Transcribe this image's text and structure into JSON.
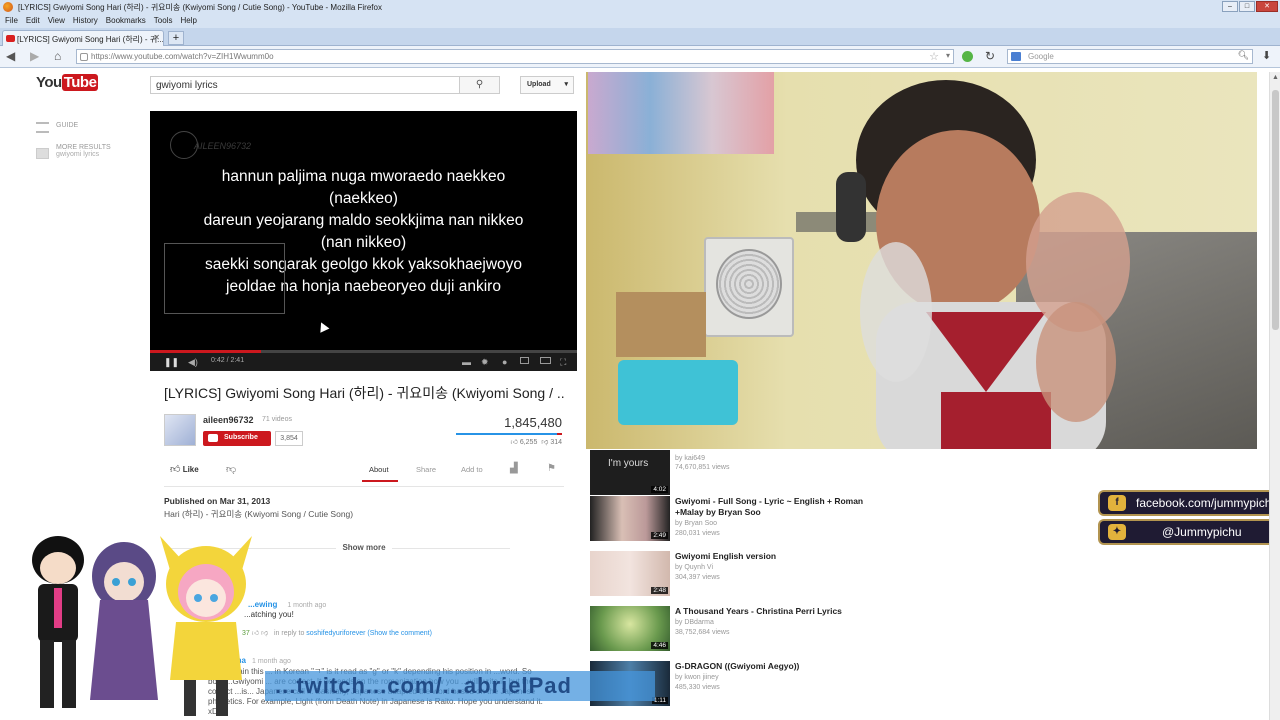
{
  "browser": {
    "window_title": "[LYRICS] Gwiyomi Song Hari (하리) - 귀요미송 (Kwiyomi Song / Cutie Song) - YouTube - Mozilla Firefox",
    "menu": [
      "File",
      "Edit",
      "View",
      "History",
      "Bookmarks",
      "Tools",
      "Help"
    ],
    "tab_title": "[LYRICS] Gwiyomi Song Hari (하리) - 귀...",
    "url": "https://www.youtube.com/watch?v=ZIH1Wwumm0o",
    "search_placeholder": "Google"
  },
  "youtube": {
    "logo_you": "You",
    "logo_tube": "Tube",
    "search_value": "gwiyomi lyrics",
    "upload_label": "Upload",
    "guide": {
      "guide_label": "GUIDE",
      "more_results": "MORE RESULTS",
      "more_results_sub": "gwiyomi lyrics"
    }
  },
  "player": {
    "watermark": "AILEEN96732",
    "lyrics": [
      "hannun paljima nuga mworaedo naekkeo",
      "(naekkeo)",
      "dareun yeojarang maldo seokkjima nan nikkeo",
      "(nan nikkeo)",
      "saekki songarak geolgo kkok yaksokhaejwoyo",
      "jeoldae na honja naebeoryeo duji ankiro"
    ],
    "time": "0:42 / 2:41",
    "progress_fraction": 0.26,
    "buffered_fraction": 0.57
  },
  "video": {
    "title": "[LYRICS] Gwiyomi Song Hari (하리) - 귀요미송 (Kwiyomi Song / ...",
    "uploader": "aileen96732",
    "video_count": "71 videos",
    "subscribe_label": "Subscribe",
    "subscriber_count": "3,854",
    "views": "1,845,480",
    "likes": "6,255",
    "dislikes": "314",
    "like_ratio": 0.95,
    "like_label": "Like",
    "tabs": [
      "About",
      "Share",
      "Add to"
    ],
    "published": "Published on Mar 31, 2013",
    "description": "Hari (하리) - 귀요미송 (Kwiyomi Song / Cutie Song)",
    "show_more": "Show more"
  },
  "comments": {
    "c1_name": "...ewing",
    "c1_ago": "1 month ago",
    "c1_text": "...atching you!",
    "c1_likes": "37",
    "c1_reply_to": "in reply to",
    "c1_reply_user": "soshifedyuriforever (Show the comment)",
    "c2_name": "...na",
    "c2_ago": "1 month ago",
    "c2_text": "...to explain this ... in Korean \"ㄱ\" is it read as \"g\" or \"k\" depending his position in ...word. So both ...Gwiyomi ... are correct. It depends on the romanization how you ...will write it, but the correct ...is... Japanese call it. Basically, Japanese adapted the word based on the Japanese phonetics. For example, Light (from Death Note) in Japanese is Raito. Hope you understand it. xD"
  },
  "related": [
    {
      "title": "",
      "by": "by kai649",
      "views": "74,670,851 views",
      "duration": "4:02",
      "thumb_text": "I'm yours"
    },
    {
      "title": "Gwiyomi - Full Song - Lyric ~ English + Roman +Malay by Bryan Soo",
      "by": "by Bryan Soo",
      "views": "280,031 views",
      "duration": "2:49",
      "thumb_text": ""
    },
    {
      "title": "Gwiyomi English version",
      "by": "by Quynh Vi",
      "views": "304,397 views",
      "duration": "2:48",
      "thumb_text": ""
    },
    {
      "title": "A Thousand Years - Christina Perri Lyrics",
      "by": "by DBdarma",
      "views": "38,752,684 views",
      "duration": "4:46",
      "thumb_text": ""
    },
    {
      "title": "G-DRAGON ((Gwiyomi Aegyo))",
      "by": "by kwon jiiney",
      "views": "485,330 views",
      "duration": "1:11",
      "thumb_text": ""
    }
  ],
  "overlay": {
    "facebook": "facebook.com/jummypichu",
    "twitter": "@Jummypichu",
    "banner": "...twitch...com/...abrielPad"
  },
  "colors": {
    "youtube_red": "#cc181e",
    "link_blue": "#2793e6",
    "overlay_bg": "#1f1b33",
    "overlay_border": "#b29450"
  },
  "icons": [
    "firefox-icon",
    "back-icon",
    "forward-icon",
    "home-icon",
    "lock-icon",
    "star-icon",
    "reload-icon",
    "google-icon",
    "search-icon",
    "download-icon",
    "guide-icon",
    "play-pause-icon",
    "volume-icon",
    "captions-icon",
    "settings-icon",
    "fullscreen-icon",
    "thumbs-up-icon",
    "thumbs-down-icon",
    "stats-icon",
    "flag-icon",
    "facebook-icon",
    "twitter-icon"
  ]
}
